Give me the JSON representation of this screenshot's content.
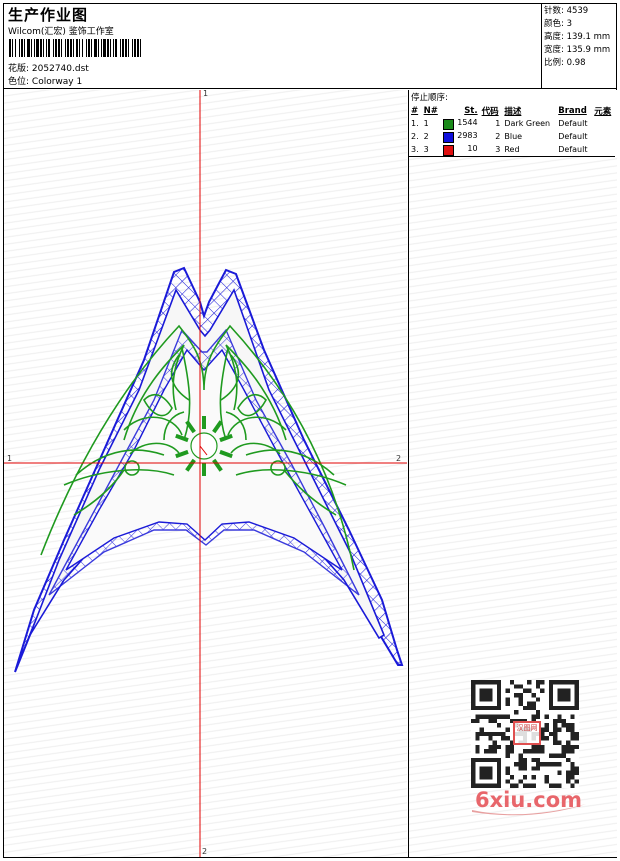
{
  "header": {
    "title": "生产作业图",
    "subtitle": "Wilcom(汇宏) 鉴饰工作室",
    "design_label": "花版:",
    "design_value": "2052740.dst",
    "colorway_label": "色位:",
    "colorway_value": "Colorway 1"
  },
  "stats": [
    {
      "label": "针数:",
      "value": "4539"
    },
    {
      "label": "颜色:",
      "value": "3"
    },
    {
      "label": "高度:",
      "value": "139.1 mm"
    },
    {
      "label": "宽度:",
      "value": "135.9 mm"
    },
    {
      "label": "比例:",
      "value": "0.98"
    }
  ],
  "axis_labels": {
    "top": "1",
    "left": "1",
    "right": "2",
    "bottom": "2"
  },
  "sequence": {
    "title": "停止顺序:",
    "columns": [
      "#",
      "N#",
      "St.",
      "代码",
      "描述",
      "Brand",
      "元素"
    ],
    "rows": [
      {
        "idx": "1.",
        "n": "1",
        "stitches": "1544",
        "code": "1",
        "desc": "Dark Green",
        "brand": "Default",
        "color": "#1a8a1a"
      },
      {
        "idx": "2.",
        "n": "2",
        "stitches": "2983",
        "code": "2",
        "desc": "Blue",
        "brand": "Default",
        "color": "#1010dd"
      },
      {
        "idx": "3.",
        "n": "3",
        "stitches": "10",
        "code": "3",
        "desc": "Red",
        "brand": "Default",
        "color": "#e01010"
      }
    ]
  },
  "qr_seal": "汉图网",
  "watermark": "6xiu.com",
  "colors": {
    "blue_thread": "#1a1ad8",
    "green_thread": "#1f9a1f",
    "red_thread": "#e01010",
    "axis": "#e00000"
  }
}
